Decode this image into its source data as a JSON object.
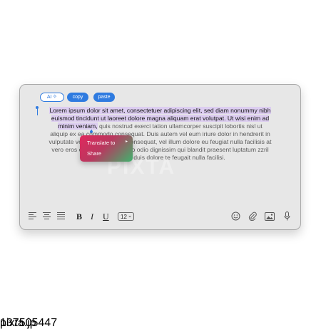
{
  "actions": {
    "ai_label": "AI",
    "copy_label": "copy",
    "paste_label": "paste"
  },
  "text": {
    "line1": "Lorem ipsum dolor sit amet, consectetuer adipiscing elit, sed diam nonummy nibh",
    "line2": "euismod tincidunt ut laoreet dolore magna aliquam erat volutpat. Ut wisi enim ad",
    "line3_sel": "minim veniam,",
    "line3_rest": " quis nostrud exerci tation ullamcorper suscipit lobortis nisl ut",
    "line4": "aliquip ex ea commodo consequat. Duis autem vel eum iriure dolor in hendrerit in",
    "line5": "vulputate velit esse molestie consequat, vel illum dolore eu feugiat nulla facilisis at",
    "line6": "vero eros et accumsan et iusto odio dignissim qui blandit praesent luptatum zzril",
    "line7": "delenit augue duis dolore te feugait nulla facilisi."
  },
  "context_menu": {
    "translate": "Translate to",
    "share": "Share"
  },
  "toolbar": {
    "bold": "B",
    "italic": "I",
    "underline": "U",
    "font_size": "12"
  },
  "icons": [
    "align-left-icon",
    "align-center-icon",
    "align-justify-icon",
    "emoji-icon",
    "attach-icon",
    "image-icon",
    "microphone-icon"
  ],
  "footer": {
    "brand": "pixta.jp",
    "image_number": "137505447"
  },
  "colors": {
    "accent": "#2f7be0",
    "highlight": "#dccdf0",
    "menu_gradient_start": "#e0285d",
    "menu_gradient_end": "#3fb36d"
  }
}
